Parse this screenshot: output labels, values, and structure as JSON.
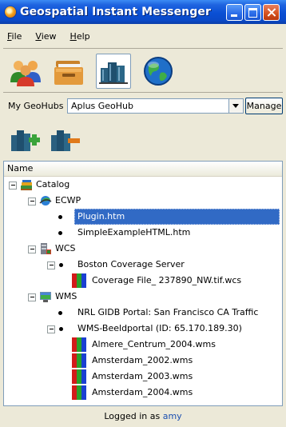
{
  "window": {
    "title": "Geospatial Instant Messenger"
  },
  "menu": [
    "File",
    "View",
    "Help"
  ],
  "toolbar": {
    "icons": [
      "people-icon",
      "folder-icon",
      "books-icon",
      "globe-icon"
    ],
    "active": "books-icon"
  },
  "geohub": {
    "label": "My GeoHubs",
    "selected": "Aplus GeoHub",
    "manage_label": "Manage"
  },
  "hub_tools": {
    "icons": [
      "add-hub-icon",
      "remove-hub-icon"
    ]
  },
  "tree": {
    "column_header": "Name",
    "nodes": [
      {
        "label": "Catalog",
        "icon": "catalog-books-icon"
      },
      {
        "label": "ECWP",
        "icon": "ecwp-globe-icon"
      },
      {
        "label": "Plugin.htm",
        "selected": true
      },
      {
        "label": "SimpleExampleHTML.htm"
      },
      {
        "label": "WCS",
        "icon": "wcs-server-icon"
      },
      {
        "label": "Boston Coverage Server"
      },
      {
        "label": "Coverage File_ 237890_NW.tif.wcs",
        "icon": "layer-stripe-icon"
      },
      {
        "label": "WMS",
        "icon": "wms-server-icon"
      },
      {
        "label": "NRL GIDB Portal: San Francisco CA Traffic"
      },
      {
        "label": "WMS-Beeldportal (ID: 65.170.189.30)"
      },
      {
        "label": "Almere_Centrum_2004.wms",
        "icon": "layer-stripe-icon"
      },
      {
        "label": "Amsterdam_2002.wms",
        "icon": "layer-stripe-icon"
      },
      {
        "label": "Amsterdam_2003.wms",
        "icon": "layer-stripe-icon"
      },
      {
        "label": "Amsterdam_2004.wms",
        "icon": "layer-stripe-icon"
      }
    ]
  },
  "status": {
    "prefix": "Logged in as",
    "user": "amy"
  },
  "colors": {
    "titlebar": "#0a4fd4",
    "selection": "#316ac5",
    "stripe_red": "#d21a1a",
    "stripe_green": "#2aa12a",
    "stripe_blue": "#1a3fd2"
  }
}
